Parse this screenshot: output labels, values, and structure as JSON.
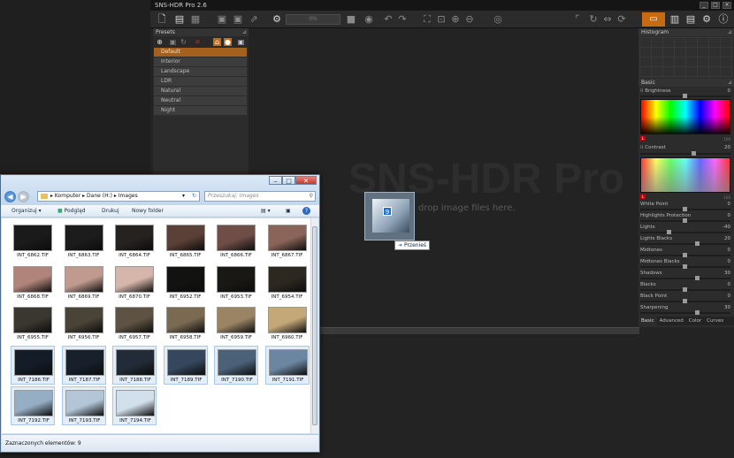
{
  "app": {
    "title": "SNS-HDR Pro 2.6",
    "zoom_placeholder": "0%",
    "watermark": "SNS-HDR Pro",
    "drop_hint": "drop image files here."
  },
  "presets": {
    "header": "Presets",
    "items": [
      "Default",
      "Interior",
      "Landscape",
      "LDR",
      "Natural",
      "Neutral",
      "Night"
    ],
    "selected": "Default"
  },
  "right_panel": {
    "histogram_header": "Histogram",
    "basic_header": "Basic",
    "brightness": {
      "label": "Brightness",
      "value": "0"
    },
    "grad_min1": "0",
    "grad_max1": "100",
    "contrast": {
      "label": "Contrast",
      "value": "20"
    },
    "grad_min2": "0",
    "grad_max2": "100",
    "sliders": [
      {
        "label": "White Point",
        "value": "0"
      },
      {
        "label": "Highlights Protection",
        "value": "0"
      },
      {
        "label": "Lights",
        "value": "-40"
      },
      {
        "label": "Lights Blacks",
        "value": "20"
      },
      {
        "label": "Midtones",
        "value": "0"
      },
      {
        "label": "Midtones Blacks",
        "value": "0"
      },
      {
        "label": "Shadows",
        "value": "30"
      },
      {
        "label": "Blacks",
        "value": "0"
      },
      {
        "label": "Black Point",
        "value": "0"
      },
      {
        "label": "Sharpening",
        "value": "30"
      }
    ],
    "tabs": [
      "Basic",
      "Advanced",
      "Color",
      "Curves"
    ]
  },
  "explorer": {
    "address": [
      "Komputer",
      "Dane (H:)",
      "Images"
    ],
    "search_placeholder": "Przeszukaj: Images",
    "commands": {
      "organize": "Organizuj",
      "preview": "Podgląd",
      "print": "Drukuj",
      "new_folder": "Nowy folder"
    },
    "status": "Zaznaczonych elementów: 9",
    "files": [
      {
        "name": "INT_6862.TIF",
        "tone": "#1a1a1a",
        "sel": false
      },
      {
        "name": "INT_6863.TIF",
        "tone": "#1c1c1c",
        "sel": false
      },
      {
        "name": "INT_6864.TIF",
        "tone": "#262220",
        "sel": false
      },
      {
        "name": "INT_6865.TIF",
        "tone": "#5a4036",
        "sel": false
      },
      {
        "name": "INT_6866.TIF",
        "tone": "#6e4e46",
        "sel": false
      },
      {
        "name": "INT_6867.TIF",
        "tone": "#8a6458",
        "sel": false
      },
      {
        "name": "INT_6868.TIF",
        "tone": "#b0847a",
        "sel": false
      },
      {
        "name": "INT_6869.TIF",
        "tone": "#c09a8e",
        "sel": false
      },
      {
        "name": "INT_6870.TIF",
        "tone": "#d6b6aa",
        "sel": false
      },
      {
        "name": "INT_6952.TIF",
        "tone": "#121210",
        "sel": false
      },
      {
        "name": "INT_6953.TIF",
        "tone": "#1a1814",
        "sel": false
      },
      {
        "name": "INT_6954.TIF",
        "tone": "#2c2820",
        "sel": false
      },
      {
        "name": "INT_6955.TIF",
        "tone": "#3a3630",
        "sel": false
      },
      {
        "name": "INT_6956.TIF",
        "tone": "#4a4338",
        "sel": false
      },
      {
        "name": "INT_6957.TIF",
        "tone": "#5e5342",
        "sel": false
      },
      {
        "name": "INT_6958.TIF",
        "tone": "#7a6a52",
        "sel": false
      },
      {
        "name": "INT_6959.TIF",
        "tone": "#9a8464",
        "sel": false
      },
      {
        "name": "INT_6960.TIF",
        "tone": "#c4a878",
        "sel": false
      },
      {
        "name": "INT_7186.TIF",
        "tone": "#141c28",
        "sel": true
      },
      {
        "name": "INT_7187.TIF",
        "tone": "#18202c",
        "sel": true
      },
      {
        "name": "INT_7188.TIF",
        "tone": "#222c38",
        "sel": true
      },
      {
        "name": "INT_7189.TIF",
        "tone": "#34475c",
        "sel": true
      },
      {
        "name": "INT_7190.TIF",
        "tone": "#4a6178",
        "sel": true
      },
      {
        "name": "INT_7191.TIF",
        "tone": "#6b86a0",
        "sel": true
      },
      {
        "name": "INT_7192.TIF",
        "tone": "#96aec4",
        "sel": true
      },
      {
        "name": "INT_7193.TIF",
        "tone": "#b2c6d8",
        "sel": true
      },
      {
        "name": "INT_7194.TIF",
        "tone": "#d2e0ec",
        "sel": true
      }
    ]
  },
  "drag": {
    "count": "9",
    "tooltip": "Przenieś"
  },
  "colors": {
    "accent": "#c86a12",
    "selected_preset": "#a4601d"
  }
}
